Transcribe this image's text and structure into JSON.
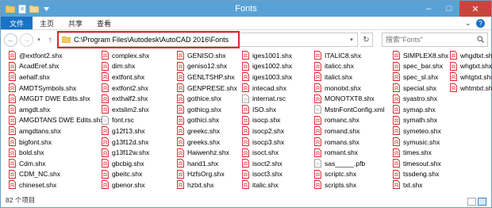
{
  "window": {
    "title": "Fonts",
    "minimize": "–",
    "maximize": "□",
    "close": "✕"
  },
  "ribbon": {
    "tabs": [
      "文件",
      "主页",
      "共享",
      "查看"
    ],
    "chevron": "⌄",
    "help": "?"
  },
  "nav": {
    "back": "←",
    "forward": "→",
    "recent": "▾",
    "up": "↑",
    "address": "C:\\Program Files\\Autodesk\\AutoCAD 2016\\Fonts",
    "address_drop": "▾",
    "refresh": "↻",
    "search_placeholder": "搜索\"Fonts\""
  },
  "colors": {
    "shx_icon": "#d9232a",
    "title_bar": "#5aa2d6",
    "file_tab": "#1a73c4",
    "highlight": "#e0262a"
  },
  "files": [
    {
      "name": "@extfont2.shx",
      "icon": "shx"
    },
    {
      "name": "AcadEref.shx",
      "icon": "shx"
    },
    {
      "name": "aehalf.shx",
      "icon": "shx"
    },
    {
      "name": "AMDTSymbols.shx",
      "icon": "shx"
    },
    {
      "name": "AMGDT DWE Edits.shx",
      "icon": "shx"
    },
    {
      "name": "amgdt.shx",
      "icon": "shx"
    },
    {
      "name": "AMGDTANS DWE Edits.shx",
      "icon": "shx"
    },
    {
      "name": "amgdtans.shx",
      "icon": "shx"
    },
    {
      "name": "bigfont.shx",
      "icon": "shx"
    },
    {
      "name": "bold.shx",
      "icon": "shx"
    },
    {
      "name": "Cdm.shx",
      "icon": "shx"
    },
    {
      "name": "CDM_NC.shx",
      "icon": "shx"
    },
    {
      "name": "chineset.shx",
      "icon": "shx"
    },
    {
      "name": "complex.shx",
      "icon": "shx"
    },
    {
      "name": "dim.shx",
      "icon": "shx"
    },
    {
      "name": "extfont.shx",
      "icon": "shx"
    },
    {
      "name": "extfont2.shx",
      "icon": "shx"
    },
    {
      "name": "exthalf2.shx",
      "icon": "shx"
    },
    {
      "name": "extslim2.shx",
      "icon": "shx"
    },
    {
      "name": "font.rsc",
      "icon": "doc"
    },
    {
      "name": "g12f13.shx",
      "icon": "shx"
    },
    {
      "name": "g13f12d.shx",
      "icon": "shx"
    },
    {
      "name": "g13f12w.shx",
      "icon": "shx"
    },
    {
      "name": "gbcbig.shx",
      "icon": "shx"
    },
    {
      "name": "gbeitc.shx",
      "icon": "shx"
    },
    {
      "name": "gbenor.shx",
      "icon": "shx"
    },
    {
      "name": "GENISO.shx",
      "icon": "shx"
    },
    {
      "name": "geniso12.shx",
      "icon": "shx"
    },
    {
      "name": "GENLTSHP.shx",
      "icon": "shx"
    },
    {
      "name": "GENPRESE.shx",
      "icon": "shx"
    },
    {
      "name": "gothice.shx",
      "icon": "shx"
    },
    {
      "name": "gothicg.shx",
      "icon": "shx"
    },
    {
      "name": "gothici.shx",
      "icon": "shx"
    },
    {
      "name": "greekc.shx",
      "icon": "shx"
    },
    {
      "name": "greeks.shx",
      "icon": "shx"
    },
    {
      "name": "Haiwenhz.shx",
      "icon": "shx"
    },
    {
      "name": "hand1.shx",
      "icon": "shx"
    },
    {
      "name": "HzfsOrg.shx",
      "icon": "shx"
    },
    {
      "name": "hztxt.shx",
      "icon": "shx"
    },
    {
      "name": "iges1001.shx",
      "icon": "shx"
    },
    {
      "name": "iges1002.shx",
      "icon": "shx"
    },
    {
      "name": "iges1003.shx",
      "icon": "shx"
    },
    {
      "name": "intecad.shx",
      "icon": "shx"
    },
    {
      "name": "internat.rsc",
      "icon": "doc"
    },
    {
      "name": "ISO.shx",
      "icon": "shx"
    },
    {
      "name": "isocp.shx",
      "icon": "shx"
    },
    {
      "name": "isocp2.shx",
      "icon": "shx"
    },
    {
      "name": "isocp3.shx",
      "icon": "shx"
    },
    {
      "name": "isoct.shx",
      "icon": "shx"
    },
    {
      "name": "isoct2.shx",
      "icon": "shx"
    },
    {
      "name": "isoct3.shx",
      "icon": "shx"
    },
    {
      "name": "italic.shx",
      "icon": "shx"
    },
    {
      "name": "ITALIC8.shx",
      "icon": "shx"
    },
    {
      "name": "italicc.shx",
      "icon": "shx"
    },
    {
      "name": "italict.shx",
      "icon": "shx"
    },
    {
      "name": "monotxt.shx",
      "icon": "shx"
    },
    {
      "name": "MONOTXT8.shx",
      "icon": "shx"
    },
    {
      "name": "MstnFontConfig.xml",
      "icon": "doc"
    },
    {
      "name": "romanc.shx",
      "icon": "shx"
    },
    {
      "name": "romand.shx",
      "icon": "shx"
    },
    {
      "name": "romans.shx",
      "icon": "shx"
    },
    {
      "name": "romant.shx",
      "icon": "shx"
    },
    {
      "name": "sas_____.pfb",
      "icon": "doc"
    },
    {
      "name": "scriptc.shx",
      "icon": "shx"
    },
    {
      "name": "scripts.shx",
      "icon": "shx"
    },
    {
      "name": "SIMPLEX8.shx",
      "icon": "shx"
    },
    {
      "name": "spec_bar.shx",
      "icon": "shx"
    },
    {
      "name": "spec_sl.shx",
      "icon": "shx"
    },
    {
      "name": "special.shx",
      "icon": "shx"
    },
    {
      "name": "syastro.shx",
      "icon": "shx"
    },
    {
      "name": "symap.shx",
      "icon": "shx"
    },
    {
      "name": "symath.shx",
      "icon": "shx"
    },
    {
      "name": "symeteo.shx",
      "icon": "shx"
    },
    {
      "name": "symusic.shx",
      "icon": "shx"
    },
    {
      "name": "times.shx",
      "icon": "shx"
    },
    {
      "name": "timesout.shx",
      "icon": "shx"
    },
    {
      "name": "tssdeng.shx",
      "icon": "shx"
    },
    {
      "name": "txt.shx",
      "icon": "shx"
    },
    {
      "name": "whgdtxt.shx",
      "icon": "shx"
    },
    {
      "name": "whgtxt.shx",
      "icon": "shx"
    },
    {
      "name": "whtgtxt.shx",
      "icon": "shx"
    },
    {
      "name": "whtmtxt.shx",
      "icon": "shx"
    }
  ],
  "status": {
    "count": "82 个项目"
  }
}
